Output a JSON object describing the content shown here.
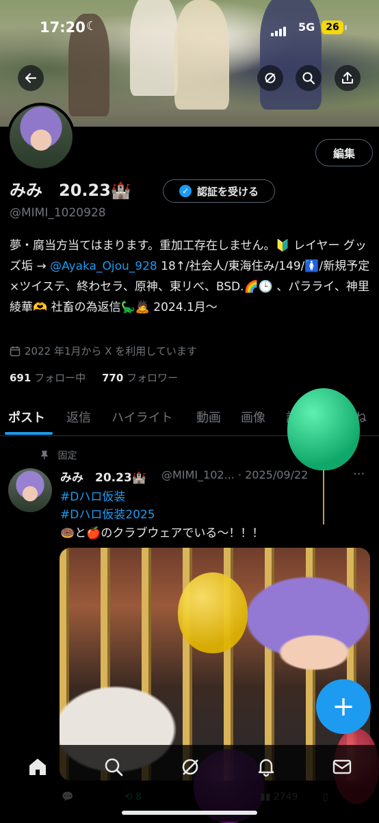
{
  "status_bar": {
    "time": "17:20",
    "network": "5G",
    "battery": "26"
  },
  "profile": {
    "edit_label": "編集",
    "display_name": "みみ　20.23🏰",
    "verify_label": "認証を受ける",
    "handle": "@MIMI_1020928",
    "bio_part1": "夢・腐当方当てはまります。重加工存在しません。🔰 レイヤー グッズ垢 → ",
    "bio_link": "@Ayaka_Ojou_928",
    "bio_part2": " 18↑/社会人/東海住み/149/🚺/新規予定×ツイステ、終わセラ、原神、東リべ、BSD.🌈🕒 、パラライ、神里綾華🫶 社畜の為返信🦕🙇 2024.1月〜",
    "joined": "2022 年1月から X を利用しています",
    "following_count": "691",
    "following_label": "フォロー中",
    "followers_count": "770",
    "followers_label": "フォロワー"
  },
  "tabs": [
    {
      "label": "ポスト"
    },
    {
      "label": "返信"
    },
    {
      "label": "ハイライト"
    },
    {
      "label": "動画"
    },
    {
      "label": "画像"
    },
    {
      "label": "記事"
    },
    {
      "label": "いいね"
    }
  ],
  "post": {
    "pinned_label": "固定",
    "author_name": "みみ　20.23🏰",
    "author_handle": "@MIMI_102... · 2025/09/22",
    "more": "···",
    "hashtag1": "#Dハロ仮装",
    "hashtag2": "#Dハロ仮装2025",
    "text": "🍩と🍎のクラブウェアでいる〜！！！",
    "retweets": "8",
    "views": "2749"
  },
  "colors": {
    "accent": "#1d9bf0",
    "background": "#000000",
    "muted": "#71767b"
  },
  "icons": [
    "back-arrow-icon",
    "x-grok-icon",
    "search-icon",
    "share-icon",
    "verified-check-icon",
    "calendar-icon",
    "pin-icon",
    "home-icon",
    "search-icon",
    "grok-icon",
    "bell-icon",
    "mail-icon",
    "compose-plus-icon"
  ]
}
